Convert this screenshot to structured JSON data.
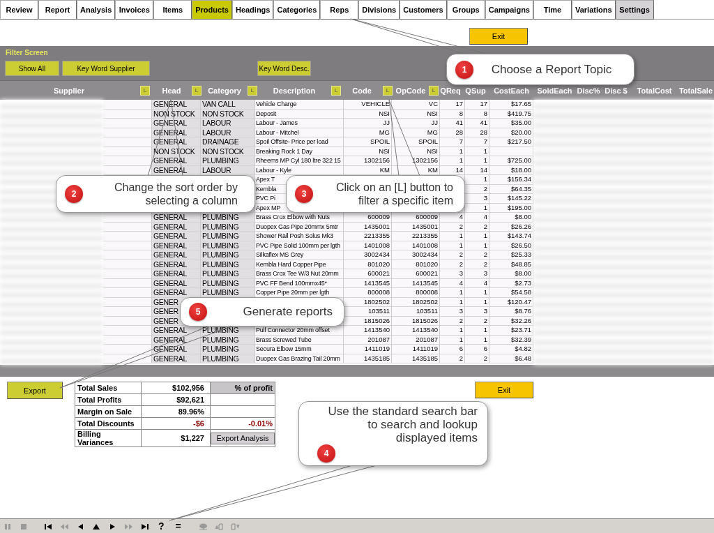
{
  "tabs": [
    {
      "label": "Review",
      "selected": false,
      "highlighted": false
    },
    {
      "label": "Report",
      "selected": false,
      "highlighted": false
    },
    {
      "label": "Analysis",
      "selected": false,
      "highlighted": false
    },
    {
      "label": "Invoices",
      "selected": false,
      "highlighted": false
    },
    {
      "label": "Items",
      "selected": false,
      "highlighted": false
    },
    {
      "label": "Products",
      "selected": true,
      "highlighted": false
    },
    {
      "label": "Headings",
      "selected": false,
      "highlighted": false
    },
    {
      "label": "Categories",
      "selected": false,
      "highlighted": false
    },
    {
      "label": "Reps",
      "selected": false,
      "highlighted": false
    },
    {
      "label": "Divisions",
      "selected": false,
      "highlighted": false
    },
    {
      "label": "Customers",
      "selected": false,
      "highlighted": false
    },
    {
      "label": "Groups",
      "selected": false,
      "highlighted": false
    },
    {
      "label": "Campaigns",
      "selected": false,
      "highlighted": false
    },
    {
      "label": "Time",
      "selected": false,
      "highlighted": false
    },
    {
      "label": "Variations",
      "selected": false,
      "highlighted": false
    },
    {
      "label": "Settings",
      "selected": false,
      "highlighted": true
    }
  ],
  "exit_top": "Exit",
  "filter": {
    "title": "Filter Screen",
    "buttons": [
      "Show All",
      "Key Word Supplier",
      "Key Word Desc."
    ]
  },
  "header": [
    {
      "kind": "label",
      "text": "Supplier"
    },
    {
      "kind": "filter",
      "text": "L"
    },
    {
      "kind": "label",
      "text": "Head"
    },
    {
      "kind": "filter",
      "text": "L"
    },
    {
      "kind": "label",
      "text": "Category"
    },
    {
      "kind": "filter",
      "text": "L"
    },
    {
      "kind": "label",
      "text": "Description"
    },
    {
      "kind": "filter",
      "text": "L"
    },
    {
      "kind": "label",
      "text": "Code"
    },
    {
      "kind": "filter",
      "text": "L"
    },
    {
      "kind": "label",
      "text": "OpCode"
    },
    {
      "kind": "filter",
      "text": "L"
    },
    {
      "kind": "label",
      "text": "QReq"
    },
    {
      "kind": "label",
      "text": "QSup"
    },
    {
      "kind": "label",
      "text": "CostEach"
    },
    {
      "kind": "label",
      "text": "SoldEach"
    },
    {
      "kind": "label",
      "text": "Disc%"
    },
    {
      "kind": "label",
      "text": "Disc $"
    },
    {
      "kind": "label",
      "text": "TotalCost"
    },
    {
      "kind": "label",
      "text": "TotalSale"
    }
  ],
  "rows": [
    {
      "head": "GENERAL",
      "category": "VAN CALL",
      "description": "Vehicle Charge",
      "code": "VEHICLE",
      "opcode": "VC",
      "qreq": "17",
      "qsup": "17",
      "cost": "$17.65"
    },
    {
      "head": "NON STOCK",
      "category": "NON STOCK",
      "description": "Deposit",
      "code": "NSI",
      "opcode": "NSI",
      "qreq": "8",
      "qsup": "8",
      "cost": "$419.75"
    },
    {
      "head": "GENERAL",
      "category": "LABOUR",
      "description": "Labour - James",
      "code": "JJ",
      "opcode": "JJ",
      "qreq": "41",
      "qsup": "41",
      "cost": "$35.00"
    },
    {
      "head": "GENERAL",
      "category": "LABOUR",
      "description": "Labour - Mitchel",
      "code": "MG",
      "opcode": "MG",
      "qreq": "28",
      "qsup": "28",
      "cost": "$20.00"
    },
    {
      "head": "GENERAL",
      "category": "DRAINAGE",
      "description": "Spoil Offsite- Price per load",
      "code": "SPOIL",
      "opcode": "SPOIL",
      "qreq": "7",
      "qsup": "7",
      "cost": "$217.50"
    },
    {
      "head": "NON STOCK",
      "category": "NON STOCK",
      "description": "Breaking Rock 1 Day",
      "code": "NSI",
      "opcode": "NSI",
      "qreq": "1",
      "qsup": "1"
    },
    {
      "head": "GENERAL",
      "category": "PLUMBING",
      "description": "Rheems MP Cyl 180 ltre 322 15",
      "code": "1302156",
      "opcode": "1302156",
      "qreq": "1",
      "qsup": "1",
      "cost": "$725.00"
    },
    {
      "head": "GENERAL",
      "category": "LABOUR",
      "description": "Labour - Kyle",
      "code": "KM",
      "opcode": "KM",
      "qreq": "14",
      "qsup": "14",
      "cost": "$18.00"
    },
    {
      "description": "Apex T",
      "qsup": "1",
      "cost": "$156.34"
    },
    {
      "description": "Kembla",
      "qsup": "2",
      "cost": "$64.35"
    },
    {
      "description": "PVC Pi",
      "qsup": "3",
      "cost": "$145.22"
    },
    {
      "description": "Apex MP",
      "qsup": "1",
      "cost": "$195.00"
    },
    {
      "head": "GENERAL",
      "category": "PLUMBING",
      "description": "Brass Crox Elbow with Nuts",
      "code": "600009",
      "opcode": "600009",
      "qreq": "4",
      "qsup": "4",
      "cost": "$8.00"
    },
    {
      "head": "GENERAL",
      "category": "PLUMBING",
      "description": "Duopex Gas Pipe 20mmx 5mtr",
      "code": "1435001",
      "opcode": "1435001",
      "qreq": "2",
      "qsup": "2",
      "cost": "$26.26"
    },
    {
      "head": "GENERAL",
      "category": "PLUMBING",
      "description": "Shower Rail Posh Solus Mk3",
      "code": "2213355",
      "opcode": "2213355",
      "qreq": "1",
      "qsup": "1",
      "cost": "$143.74"
    },
    {
      "head": "GENERAL",
      "category": "PLUMBING",
      "description": "PVC Pipe Solid 100mm per lgth",
      "code": "1401008",
      "opcode": "1401008",
      "qreq": "1",
      "qsup": "1",
      "cost": "$26.50"
    },
    {
      "head": "GENERAL",
      "category": "PLUMBING",
      "description": "Silkaflex MS Grey",
      "code": "3002434",
      "opcode": "3002434",
      "qreq": "2",
      "qsup": "2",
      "cost": "$25.33"
    },
    {
      "head": "GENERAL",
      "category": "PLUMBING",
      "description": "Kembla Hard Copper Pipe",
      "code": "801020",
      "opcode": "801020",
      "qreq": "2",
      "qsup": "2",
      "cost": "$48.85"
    },
    {
      "head": "GENERAL",
      "category": "PLUMBING",
      "description": "Brass Crox Tee W/3 Nut 20mm",
      "code": "600021",
      "opcode": "600021",
      "qreq": "3",
      "qsup": "3",
      "cost": "$8.00"
    },
    {
      "head": "GENERAL",
      "category": "PLUMBING",
      "description": "PVC FF Bend 100mmx45*",
      "code": "1413545",
      "opcode": "1413545",
      "qreq": "4",
      "qsup": "4",
      "cost": "$2.73"
    },
    {
      "head": "GENERAL",
      "category": "PLUMBING",
      "description": "Copper Pipe 20mm per lgth",
      "code": "800008",
      "opcode": "800008",
      "qreq": "1",
      "qsup": "1",
      "cost": "$54.58"
    },
    {
      "head": "GENER",
      "code": "1802502",
      "opcode": "1802502",
      "qreq": "1",
      "qsup": "1",
      "cost": "$120.47"
    },
    {
      "head": "GENER",
      "code": "103511",
      "opcode": "103511",
      "qreq": "3",
      "qsup": "3",
      "cost": "$8.76"
    },
    {
      "head": "GENER",
      "code": "1815026",
      "opcode": "1815026",
      "qreq": "2",
      "qsup": "2",
      "cost": "$32.26"
    },
    {
      "head": "GENERAL",
      "category": "PLUMBING",
      "description": "Pull Connector 20mm offset",
      "code": "1413540",
      "opcode": "1413540",
      "qreq": "1",
      "qsup": "1",
      "cost": "$23.71"
    },
    {
      "head": "GENERAL",
      "category": "PLUMBING",
      "description": "Brass Screwed Tube",
      "code": "201087",
      "opcode": "201087",
      "qreq": "1",
      "qsup": "1",
      "cost": "$32.39"
    },
    {
      "head": "GENERAL",
      "category": "PLUMBING",
      "description": "Secura Elbow 15mm",
      "code": "1411019",
      "opcode": "1411019",
      "qreq": "6",
      "qsup": "6",
      "cost": "$4.82"
    },
    {
      "head": "GENERAL",
      "category": "PLUMBING",
      "description": "Duopex Gas Brazing Tail 20mm",
      "code": "1435185",
      "opcode": "1435185",
      "qreq": "2",
      "qsup": "2",
      "cost": "$6.48"
    }
  ],
  "export_button": "Export",
  "exit_bottom": "Exit",
  "summary": [
    {
      "label": "Total Sales",
      "value": "$102,956",
      "negative": false,
      "kind": "heading",
      "note": "% of profit"
    },
    {
      "label": "Total Profits",
      "value": "$92,621",
      "negative": false
    },
    {
      "label": "Margin on Sale",
      "value": "89.96%",
      "negative": false
    },
    {
      "label": "Total Discounts",
      "value": "-$6",
      "negative": true,
      "kind": "value",
      "note": "-0.01%"
    },
    {
      "label": "Billing Variances",
      "value": "$1,227",
      "negative": false,
      "kind": "button",
      "note": "Export Analysis"
    }
  ],
  "callouts": [
    {
      "number": "1",
      "text": "Choose a Report Topic"
    },
    {
      "number": "2",
      "text": "Change the sort order by selecting a column"
    },
    {
      "number": "3",
      "text": "Click on an [L] button to filter a specific item"
    },
    {
      "number": "5",
      "text": "Generate reports"
    },
    {
      "number": "4",
      "text": "Use the standard search bar to search and lookup displayed items"
    }
  ],
  "toolbar": [
    {
      "kind": "pause",
      "disabled": true
    },
    {
      "kind": "stop",
      "disabled": true
    },
    {
      "kind": "first",
      "disabled": false
    },
    {
      "kind": "rewind",
      "disabled": true
    },
    {
      "kind": "prev",
      "disabled": false
    },
    {
      "kind": "up",
      "disabled": false
    },
    {
      "kind": "next",
      "disabled": false
    },
    {
      "kind": "forward",
      "disabled": true
    },
    {
      "kind": "last",
      "disabled": false
    },
    {
      "kind": "text",
      "label": "?",
      "disabled": false
    },
    {
      "kind": "text",
      "label": "=",
      "disabled": false
    },
    {
      "kind": "tree",
      "disabled": true
    },
    {
      "kind": "page-up",
      "disabled": true
    },
    {
      "kind": "page-down",
      "disabled": true
    }
  ]
}
